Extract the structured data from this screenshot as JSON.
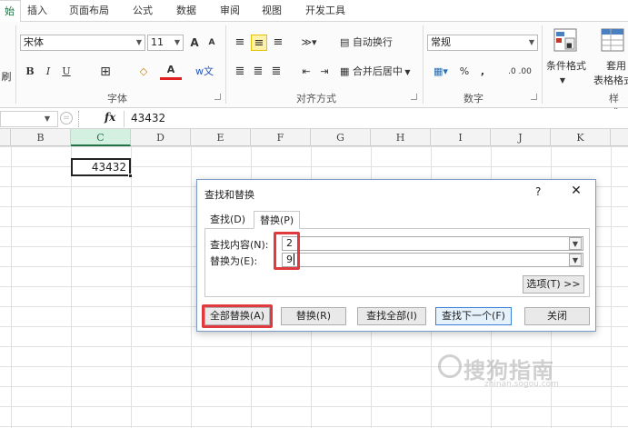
{
  "ribbon_tabs": [
    "始",
    "插入",
    "页面布局",
    "公式",
    "数据",
    "审阅",
    "视图",
    "开发工具"
  ],
  "font": {
    "name": "宋体",
    "size": "11",
    "grow": "A",
    "shrink": "A",
    "bold": "B",
    "italic": "I",
    "underline": "U",
    "border": "⊞",
    "fill": "◇",
    "color": "A",
    "phonetic": "ㅤ",
    "label": "字体"
  },
  "clipboard_fragment": "刷",
  "alignment": {
    "wrap_label": "自动换行",
    "merge_label": "合并后居中",
    "label": "对齐方式"
  },
  "number": {
    "format": "常规",
    "percent": "%",
    "comma": ",",
    "inc_dec": ".0 .00",
    "label": "数字"
  },
  "styles": {
    "conditional": "条件格式",
    "table_line1": "套用",
    "table_line2": "表格格式",
    "label": "样式"
  },
  "formula_bar": {
    "fx": "fx",
    "value": "43432"
  },
  "columns": [
    "B",
    "C",
    "D",
    "E",
    "F",
    "G",
    "H",
    "I",
    "J",
    "K"
  ],
  "selected_column": "C",
  "cell_value": "43432",
  "dialog": {
    "title": "查找和替换",
    "help": "?",
    "close": "✕",
    "tabs": [
      "查找(D)",
      "替换(P)"
    ],
    "find_label": "查找内容(N):",
    "find_value": "2",
    "replace_label": "替换为(E):",
    "replace_value": "9",
    "options_button": "选项(T) >>",
    "buttons": [
      "全部替换(A)",
      "替换(R)",
      "查找全部(I)",
      "查找下一个(F)",
      "关闭"
    ]
  },
  "watermark": {
    "text": "搜狗指南",
    "sub": "zhinan.sogou.com"
  },
  "colors": {
    "accent": "#217346",
    "highlight_box": "#e0393e",
    "dialog_border": "#7a9cc6"
  }
}
